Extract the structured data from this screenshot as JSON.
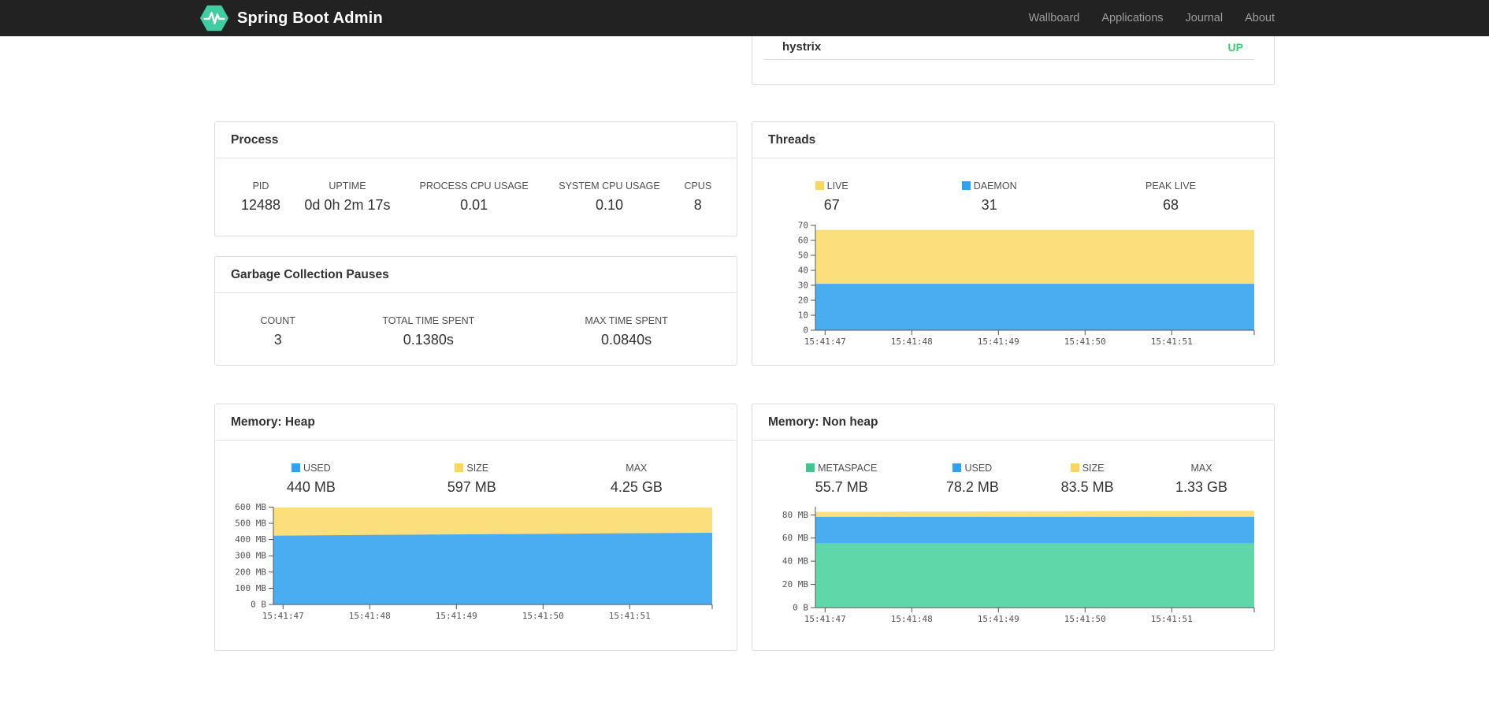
{
  "navbar": {
    "brand": "Spring Boot Admin",
    "items": [
      {
        "label": "Wallboard"
      },
      {
        "label": "Applications"
      },
      {
        "label": "Journal"
      },
      {
        "label": "About"
      }
    ]
  },
  "application_row": {
    "name": "hystrix",
    "status": "UP",
    "status_color": "#36CE6C"
  },
  "cards": {
    "process": {
      "title": "Process",
      "metrics": [
        {
          "label": "PID",
          "value": "12488"
        },
        {
          "label": "UPTIME",
          "value": "0d 0h 2m 17s"
        },
        {
          "label": "PROCESS CPU USAGE",
          "value": "0.01"
        },
        {
          "label": "SYSTEM CPU USAGE",
          "value": "0.10"
        },
        {
          "label": "CPUS",
          "value": "8"
        }
      ]
    },
    "gc": {
      "title": "Garbage Collection Pauses",
      "metrics": [
        {
          "label": "COUNT",
          "value": "3"
        },
        {
          "label": "TOTAL TIME SPENT",
          "value": "0.1380s"
        },
        {
          "label": "MAX TIME SPENT",
          "value": "0.0840s"
        }
      ]
    },
    "threads": {
      "title": "Threads",
      "metrics": [
        {
          "label": "LIVE",
          "value": "67",
          "swatch": "#F9D65D"
        },
        {
          "label": "DAEMON",
          "value": "31",
          "swatch": "#2DA3F1"
        },
        {
          "label": "PEAK LIVE",
          "value": "68"
        }
      ]
    },
    "heap": {
      "title": "Memory: Heap",
      "metrics": [
        {
          "label": "USED",
          "value": "440 MB",
          "swatch": "#2DA3F1"
        },
        {
          "label": "SIZE",
          "value": "597 MB",
          "swatch": "#F9D65D"
        },
        {
          "label": "MAX",
          "value": "4.25 GB"
        }
      ]
    },
    "nonheap": {
      "title": "Memory: Non heap",
      "metrics": [
        {
          "label": "METASPACE",
          "value": "55.7 MB",
          "swatch": "#3EC591"
        },
        {
          "label": "USED",
          "value": "78.2 MB",
          "swatch": "#2DA3F1"
        },
        {
          "label": "SIZE",
          "value": "83.5 MB",
          "swatch": "#F9D65D"
        },
        {
          "label": "MAX",
          "value": "1.33 GB"
        }
      ]
    }
  },
  "chart_data": [
    {
      "type": "area",
      "stacked": true,
      "title": "Threads",
      "legend": [
        "LIVE",
        "DAEMON"
      ],
      "x_ticks": [
        "15:41:47",
        "15:41:48",
        "15:41:49",
        "15:41:50",
        "15:41:51"
      ],
      "x_tick_frac_start": 0.022,
      "x_tick_frac_step": 0.1975,
      "y_ticks": [
        {
          "v": 0,
          "label": "0"
        },
        {
          "v": 10,
          "label": "10"
        },
        {
          "v": 20,
          "label": "20"
        },
        {
          "v": 30,
          "label": "30"
        },
        {
          "v": 40,
          "label": "40"
        },
        {
          "v": 50,
          "label": "50"
        },
        {
          "v": 60,
          "label": "60"
        },
        {
          "v": 70,
          "label": "70"
        }
      ],
      "ylim": [
        0,
        70.5
      ],
      "bands_mode": "cumulative_tops",
      "bands": [
        {
          "name": "DAEMON",
          "color": "#4AACF1",
          "values": [
            31,
            31
          ]
        },
        {
          "name": "LIVE",
          "color": "#FCDF7D",
          "values": [
            67,
            67
          ]
        }
      ]
    },
    {
      "type": "area",
      "stacked": true,
      "title": "Memory: Heap",
      "legend": [
        "USED",
        "SIZE"
      ],
      "x_ticks": [
        "15:41:47",
        "15:41:48",
        "15:41:49",
        "15:41:50",
        "15:41:51"
      ],
      "x_tick_frac_start": 0.022,
      "x_tick_frac_step": 0.1975,
      "y_ticks": [
        {
          "v": 0,
          "label": "0 B"
        },
        {
          "v": 100,
          "label": "100 MB"
        },
        {
          "v": 200,
          "label": "200 MB"
        },
        {
          "v": 300,
          "label": "300 MB"
        },
        {
          "v": 400,
          "label": "400 MB"
        },
        {
          "v": 500,
          "label": "500 MB"
        },
        {
          "v": 600,
          "label": "600 MB"
        }
      ],
      "ylim": [
        0,
        602
      ],
      "bands_mode": "cumulative_tops",
      "bands": [
        {
          "name": "USED",
          "color": "#4AACF1",
          "values": [
            424,
            426,
            428,
            430,
            432,
            434,
            436,
            438,
            440,
            442
          ]
        },
        {
          "name": "SIZE",
          "color": "#FCDF7D",
          "values": [
            597,
            597
          ]
        }
      ]
    },
    {
      "type": "area",
      "stacked": true,
      "title": "Memory: Non heap",
      "legend": [
        "METASPACE",
        "USED",
        "SIZE"
      ],
      "x_ticks": [
        "15:41:47",
        "15:41:48",
        "15:41:49",
        "15:41:50",
        "15:41:51"
      ],
      "x_tick_frac_start": 0.022,
      "x_tick_frac_step": 0.1975,
      "y_ticks": [
        {
          "v": 0,
          "label": "0 B"
        },
        {
          "v": 20,
          "label": "20 MB"
        },
        {
          "v": 40,
          "label": "40 MB"
        },
        {
          "v": 60,
          "label": "60 MB"
        },
        {
          "v": 80,
          "label": "80 MB"
        }
      ],
      "ylim": [
        0,
        87
      ],
      "bands_mode": "cumulative_tops",
      "bands": [
        {
          "name": "METASPACE",
          "color": "#5FD7A9",
          "values": [
            55.7,
            55.7
          ]
        },
        {
          "name": "USED",
          "color": "#4AACF1",
          "values": [
            78.2,
            78.2
          ]
        },
        {
          "name": "SIZE",
          "color": "#FCDF7D",
          "values": [
            82.6,
            82.6,
            82.9,
            82.9,
            83.1,
            83.2,
            83.3,
            83.4,
            83.5,
            83.5
          ]
        }
      ]
    }
  ]
}
